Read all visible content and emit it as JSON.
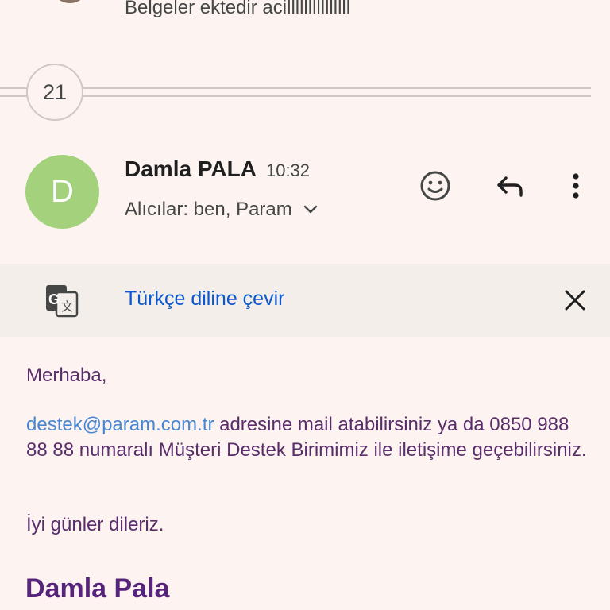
{
  "previous_message": {
    "snippet": "Belgeler ektedir acilllllllllllllll"
  },
  "collapsed": {
    "count": "21"
  },
  "message": {
    "avatar_letter": "D",
    "sender": "Damla PALA",
    "time": "10:32",
    "recipients": "Alıcılar: ben, Param",
    "icons": {
      "emoji": "emoji-reaction-icon",
      "reply": "reply-icon",
      "more": "more-vert-icon"
    }
  },
  "translate": {
    "icon": "translate-icon",
    "link": "Türkçe diline çevir",
    "close_icon": "close-icon"
  },
  "body": {
    "greeting": "Merhaba,",
    "email": "destek@param.com.tr",
    "paragraph_rest": " adresine mail atabilirsiniz ya da 0850 988 88 88 numaralı Müşteri Destek Birimimiz ile iletişime geçebilirsiniz.",
    "closing": "İyi günler dileriz.",
    "signature": "Damla Pala"
  },
  "colors": {
    "avatar": "#a4d17c",
    "link": "#0b57d0",
    "body_text": "#5a2d6b",
    "signature": "#56247a",
    "background": "#fdf4f1"
  }
}
